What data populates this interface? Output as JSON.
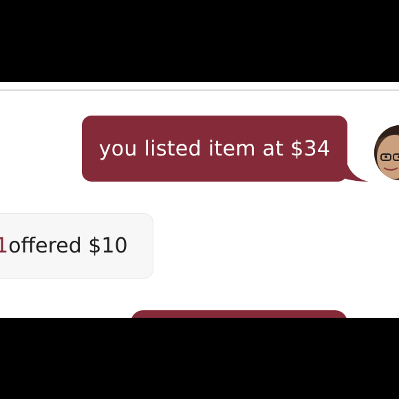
{
  "chat": {
    "messages": [
      {
        "direction": "sent",
        "text": "you listed item at $34"
      },
      {
        "direction": "received",
        "user_fragment": "1",
        "text": " offered $10"
      },
      {
        "direction": "sent",
        "text": ""
      }
    ],
    "avatar_alt": "seller avatar"
  },
  "colors": {
    "sent_bubble": "#842a38",
    "received_bubble": "#f7f7f7",
    "link": "#842a38",
    "frame": "#000000"
  }
}
